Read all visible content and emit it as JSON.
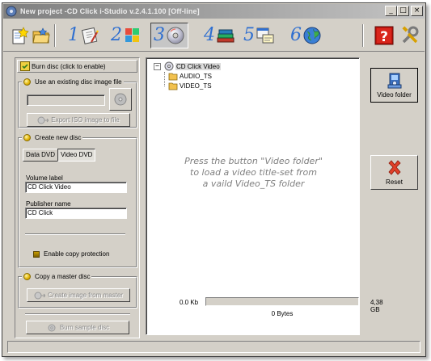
{
  "window": {
    "title": "New project -CD Click i-Studio v.2.4.1.100 [Off-line]",
    "controls": {
      "minimize": "_",
      "maximize": "□",
      "close": "×"
    }
  },
  "toolbar": {
    "steps": [
      {
        "number": "1",
        "icon": "wizard-icon"
      },
      {
        "number": "2",
        "icon": "media-icon"
      },
      {
        "number": "3",
        "icon": "disc-icon",
        "active": true
      },
      {
        "number": "4",
        "icon": "books-icon"
      },
      {
        "number": "5",
        "icon": "properties-icon"
      },
      {
        "number": "6",
        "icon": "globe-icon"
      }
    ],
    "help_icon": "help-icon",
    "tools_icon": "tools-icon"
  },
  "left": {
    "burn_disc": "Burn disc (click to enable)",
    "existing_image": {
      "title": "Use an existing disc image file",
      "path_value": "",
      "export_button": "Export ISO image to file"
    },
    "create_new": {
      "title": "Create new disc",
      "tabs": [
        "Data DVD",
        "Video DVD"
      ],
      "active_tab": "Video DVD",
      "volume_label": "Volume label",
      "volume_value": "CD Click Video",
      "publisher_label": "Publisher name",
      "publisher_value": "CD Click",
      "copy_protection": "Enable copy protection"
    },
    "master": {
      "title": "Copy a master disc",
      "create_button": "Create image from master"
    },
    "burn_sample": "Burn sample disc"
  },
  "tree": {
    "root": "CD Click Video",
    "children": [
      "AUDIO_TS",
      "VIDEO_TS"
    ]
  },
  "hint": {
    "line1": "Press the button \"Video folder\"",
    "line2": "to load a video title-set from",
    "line3": "a vaild Video_TS folder"
  },
  "usage": {
    "used": "0.0 Kb",
    "capacity": "4,38 GB",
    "bytes": "0 Bytes",
    "fill_fraction": 0
  },
  "actions": {
    "video_folder": "Video folder",
    "reset": "Reset"
  }
}
